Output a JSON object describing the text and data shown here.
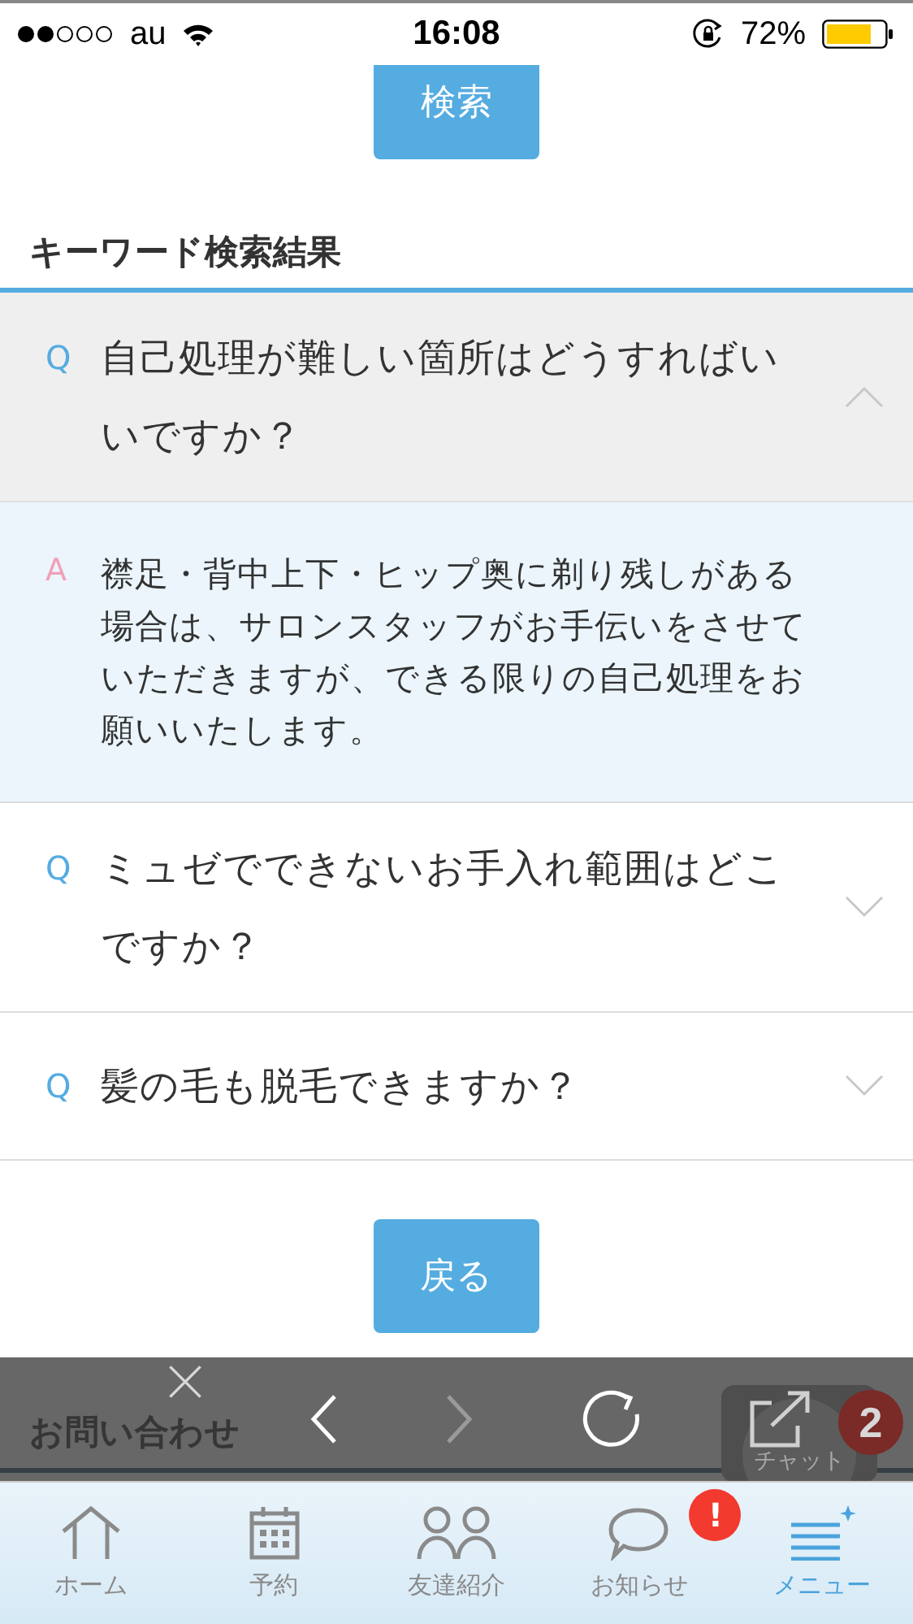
{
  "status_bar": {
    "carrier": "au",
    "time": "16:08",
    "battery": "72%"
  },
  "search_button": "検索",
  "results": {
    "title": "キーワード検索結果",
    "items": [
      {
        "q_mark": "Q",
        "a_mark": "A",
        "question": "自己処理が難しい箇所はどうすればいいですか？",
        "expanded": true,
        "answer": "襟足・背中上下・ヒップ奥に剃り残しがある場合は、サロンスタッフがお手伝いをさせていただきますが、できる限りの自己処理をお願いいたします。"
      },
      {
        "q_mark": "Q",
        "question": "ミュゼでできないお手入れ範囲はどこですか？",
        "expanded": false
      },
      {
        "q_mark": "Q",
        "question": "髪の毛も脱毛できますか？",
        "expanded": false
      }
    ]
  },
  "back_button": "戻る",
  "contact": {
    "title": "お問い合わせ",
    "chat": {
      "label": "チャット",
      "badge": "2"
    }
  },
  "browser_toolbar": [
    {
      "kind": "close",
      "disabled": false
    },
    {
      "kind": "back",
      "disabled": false
    },
    {
      "kind": "forward",
      "disabled": true
    },
    {
      "kind": "reload",
      "disabled": false
    },
    {
      "kind": "share",
      "disabled": false
    }
  ],
  "tab_bar": [
    {
      "kind": "home",
      "label": "ホーム",
      "selected": false
    },
    {
      "kind": "calendar",
      "label": "予約",
      "selected": false
    },
    {
      "kind": "friends",
      "label": "友達紹介",
      "selected": false
    },
    {
      "kind": "news",
      "label": "お知らせ",
      "selected": false,
      "badge": "!"
    },
    {
      "kind": "menu",
      "label": "メニュー",
      "selected": true
    }
  ]
}
